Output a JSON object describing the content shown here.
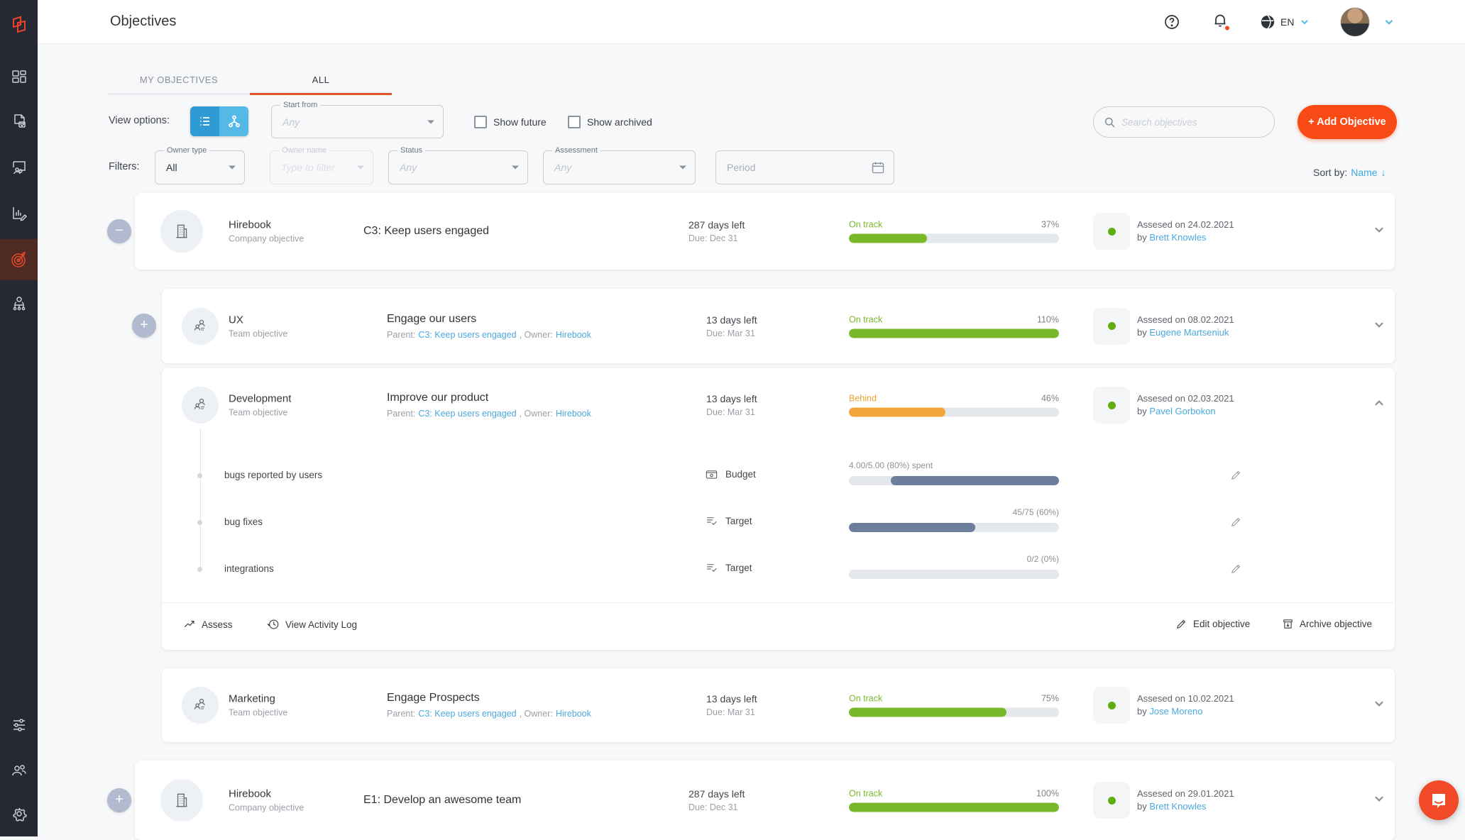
{
  "header": {
    "title": "Objectives",
    "lang": "EN"
  },
  "sidebar": {
    "icons": [
      "logo",
      "dashboard",
      "check-ins",
      "meetings",
      "kpis",
      "objectives",
      "org-chart",
      "preferences",
      "people",
      "settings"
    ],
    "active": "objectives"
  },
  "tabs": {
    "my": "MY OBJECTIVES",
    "all": "ALL"
  },
  "controls": {
    "view_options_label": "View options:",
    "start_from": {
      "label": "Start from",
      "value": "Any"
    },
    "show_future": "Show future",
    "show_archived": "Show archived",
    "search_placeholder": "Search objectives",
    "add_objective": "+ Add Objective",
    "filters_label": "Filters:",
    "owner_type": {
      "label": "Owner type",
      "value": "All"
    },
    "owner_name": {
      "label": "Owner name",
      "value": "Type to filter"
    },
    "status": {
      "label": "Status",
      "value": "Any"
    },
    "assessment": {
      "label": "Assessment",
      "value": "Any"
    },
    "period": {
      "placeholder": "Period"
    },
    "sort_label": "Sort by:",
    "sort_value": "Name",
    "sort_arrow": "↓"
  },
  "colors": {
    "accent": "#f84a15",
    "on_track": "#79b829",
    "behind": "#f3a43a",
    "kr_fill": "#6d7d9d",
    "link": "#4aa9de"
  },
  "rows": [
    {
      "owner": "Hirebook",
      "owner_type": "Company objective",
      "title": "C3: Keep users engaged",
      "days_left": "287 days left",
      "due": "Due: Dec 31",
      "status": "On track",
      "percent": "37%",
      "progress": 37,
      "assessed": "Assesed on 24.02.2021",
      "assessed_by_label": "by",
      "assessed_by": "Brett Knowles",
      "expand": "−"
    },
    {
      "owner": "UX",
      "owner_type": "Team objective",
      "title": "Engage our users",
      "parent_label": "Parent:",
      "parent_link": "C3: Keep users engaged",
      "owner_label": ", Owner:",
      "owner_link": "Hirebook",
      "days_left": "13 days left",
      "due": "Due: Mar 31",
      "status": "On track",
      "percent": "110%",
      "progress": 100,
      "assessed": "Assesed on 08.02.2021",
      "assessed_by_label": "by",
      "assessed_by": "Eugene Martseniuk",
      "expand": "+"
    },
    {
      "owner": "Development",
      "owner_type": "Team objective",
      "title": "Improve our product",
      "parent_label": "Parent:",
      "parent_link": "C3: Keep users engaged",
      "owner_label": ", Owner:",
      "owner_link": "Hirebook",
      "days_left": "13 days left",
      "due": "Due: Mar 31",
      "status": "Behind",
      "percent": "46%",
      "progress": 46,
      "assessed": "Assesed on 02.03.2021",
      "assessed_by_label": "by",
      "assessed_by": "Pavel Gorbokon",
      "key_results": [
        {
          "name": "bugs reported by users",
          "metric": "Budget",
          "value": "4.00/5.00 (80%) spent",
          "progress": 80
        },
        {
          "name": "bug fixes",
          "metric": "Target",
          "value": "45/75 (60%)",
          "progress": 60
        },
        {
          "name": "integrations",
          "metric": "Target",
          "value": "0/2 (0%)",
          "progress": 0
        }
      ],
      "actions": {
        "assess": "Assess",
        "view_log": "View Activity Log",
        "edit": "Edit objective",
        "archive": "Archive objective"
      }
    },
    {
      "owner": "Marketing",
      "owner_type": "Team objective",
      "title": "Engage Prospects",
      "parent_label": "Parent:",
      "parent_link": "C3: Keep users engaged",
      "owner_label": ", Owner:",
      "owner_link": "Hirebook",
      "days_left": "13 days left",
      "due": "Due: Mar 31",
      "status": "On track",
      "percent": "75%",
      "progress": 75,
      "assessed": "Assesed on 10.02.2021",
      "assessed_by_label": "by",
      "assessed_by": "Jose Moreno"
    },
    {
      "owner": "Hirebook",
      "owner_type": "Company objective",
      "title": "E1: Develop an awesome team",
      "days_left": "287 days left",
      "due": "Due: Dec 31",
      "status": "On track",
      "percent": "100%",
      "progress": 100,
      "assessed": "Assesed on 29.01.2021",
      "assessed_by_label": "by",
      "assessed_by": "Brett Knowles",
      "expand": "+"
    }
  ]
}
